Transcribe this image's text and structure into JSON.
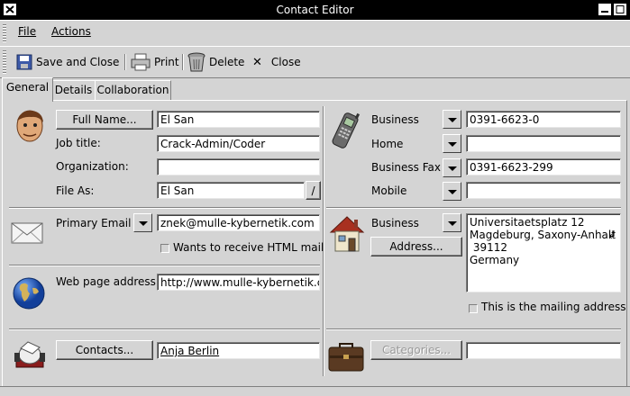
{
  "window": {
    "title": "Contact Editor"
  },
  "menubar": {
    "file": "File",
    "actions": "Actions"
  },
  "toolbar": {
    "save_close": "Save and Close",
    "print": "Print",
    "delete": "Delete",
    "close": "Close"
  },
  "tabs": [
    "General",
    "Details",
    "Collaboration"
  ],
  "identity": {
    "full_name_button": "Full Name...",
    "full_name_value": "El San",
    "job_title_label": "Job title:",
    "job_title_value": "Crack-Admin/Coder",
    "organization_label": "Organization:",
    "organization_value": "",
    "file_as_label": "File As:",
    "file_as_value": "El San",
    "file_as_button": "/"
  },
  "phones": [
    {
      "label": "Business",
      "value": "0391-6623-0"
    },
    {
      "label": "Home",
      "value": ""
    },
    {
      "label": "Business Fax",
      "value": "0391-6623-299"
    },
    {
      "label": "Mobile",
      "value": ""
    }
  ],
  "email": {
    "label": "Primary Email",
    "value": "znek@mulle-kybernetik.com",
    "html_mail_label": "Wants to receive HTML mail"
  },
  "address": {
    "label": "Business",
    "button": "Address...",
    "lines": [
      "Universitaetsplatz 12",
      "Magdeburg, Saxony-Anhalt",
      " 39112",
      "Germany"
    ],
    "wrap_marker": "↲",
    "mailing_label": "This is the mailing address"
  },
  "web": {
    "label": "Web page address:",
    "value": "http://www.mulle-kybernetik.com"
  },
  "contacts": {
    "button": "Contacts...",
    "value": "Anja Berlin",
    "categories_button": "Categories...",
    "categories_value": ""
  },
  "icons": {
    "person": "person-face-icon",
    "phone": "cellphone-icon",
    "mail": "envelope-icon",
    "house": "house-icon",
    "globe": "globe-icon",
    "contacts": "rolodex-icon",
    "categories": "briefcase-icon",
    "save": "floppy-disk-icon",
    "print": "printer-icon",
    "delete": "trash-can-icon",
    "close": "x-icon"
  }
}
